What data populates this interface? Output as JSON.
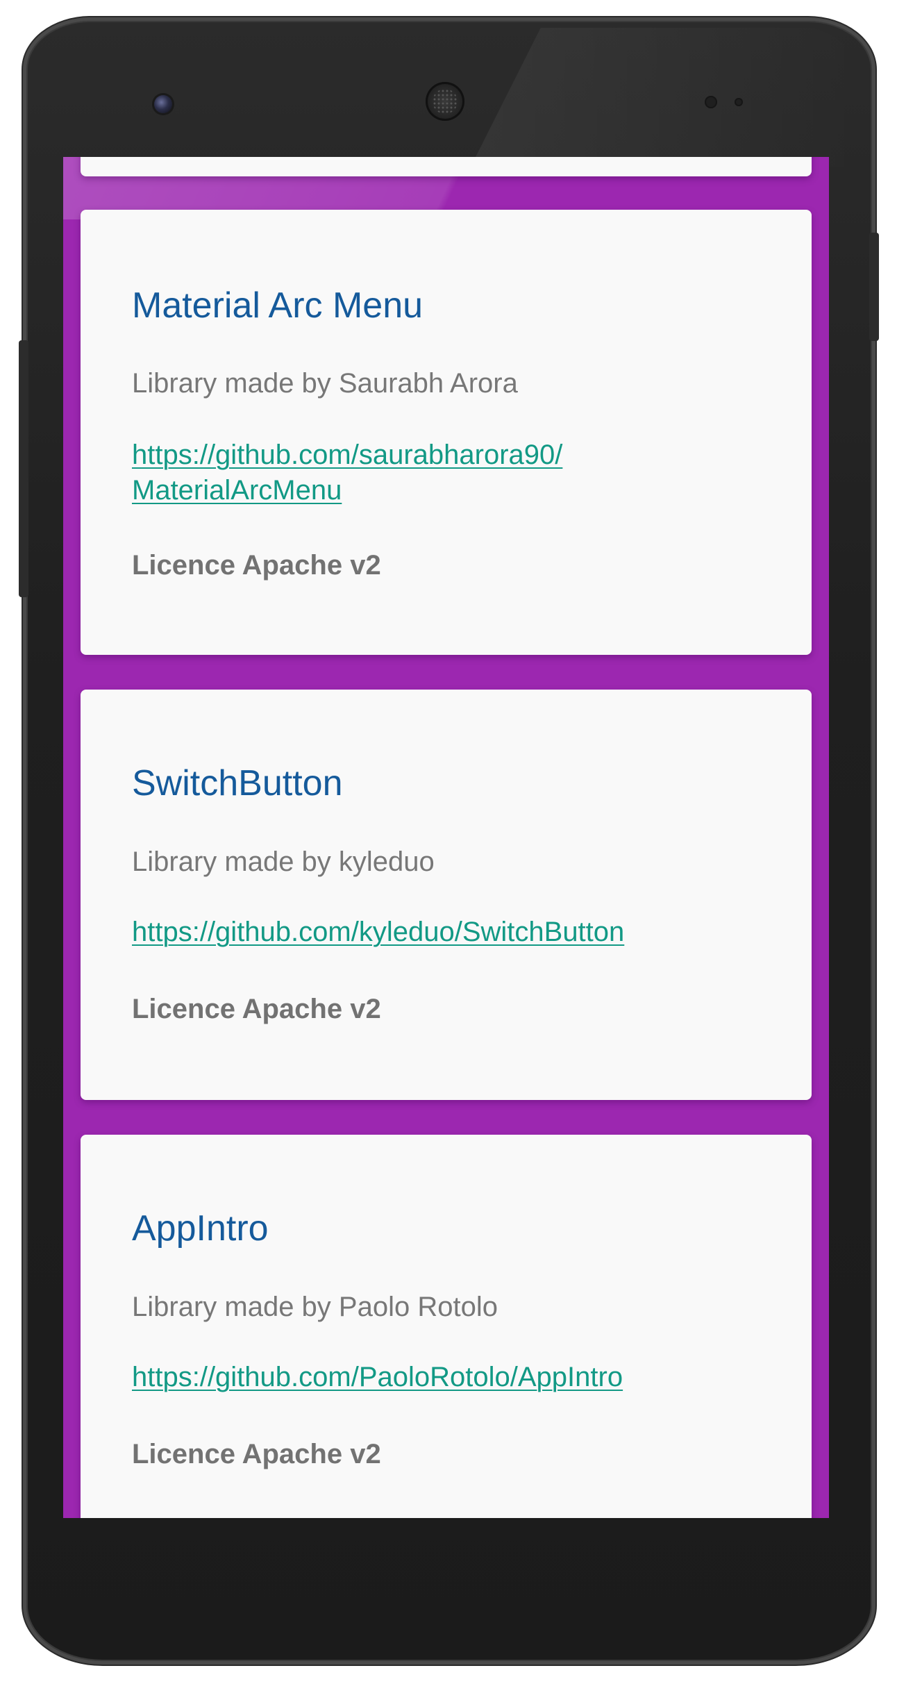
{
  "theme": {
    "background": "#9c27b0",
    "card": "#f9f9f9",
    "title_color": "#155a9b",
    "link_color": "#129985",
    "text_color": "#777777"
  },
  "libraries": [
    {
      "title": "Material Arc Menu",
      "author": "Library made by Saurabh Arora",
      "link_lines": [
        "https://github.com/saurabharora90/",
        "MaterialArcMenu"
      ],
      "licence": "Licence Apache v2"
    },
    {
      "title": "SwitchButton",
      "author": "Library made by kyleduo",
      "link_lines": [
        "https://github.com/kyleduo/SwitchButton"
      ],
      "licence": "Licence Apache v2"
    },
    {
      "title": "AppIntro",
      "author": "Library made by Paolo Rotolo",
      "link_lines": [
        "https://github.com/PaoloRotolo/AppIntro"
      ],
      "licence": "Licence Apache v2"
    }
  ]
}
